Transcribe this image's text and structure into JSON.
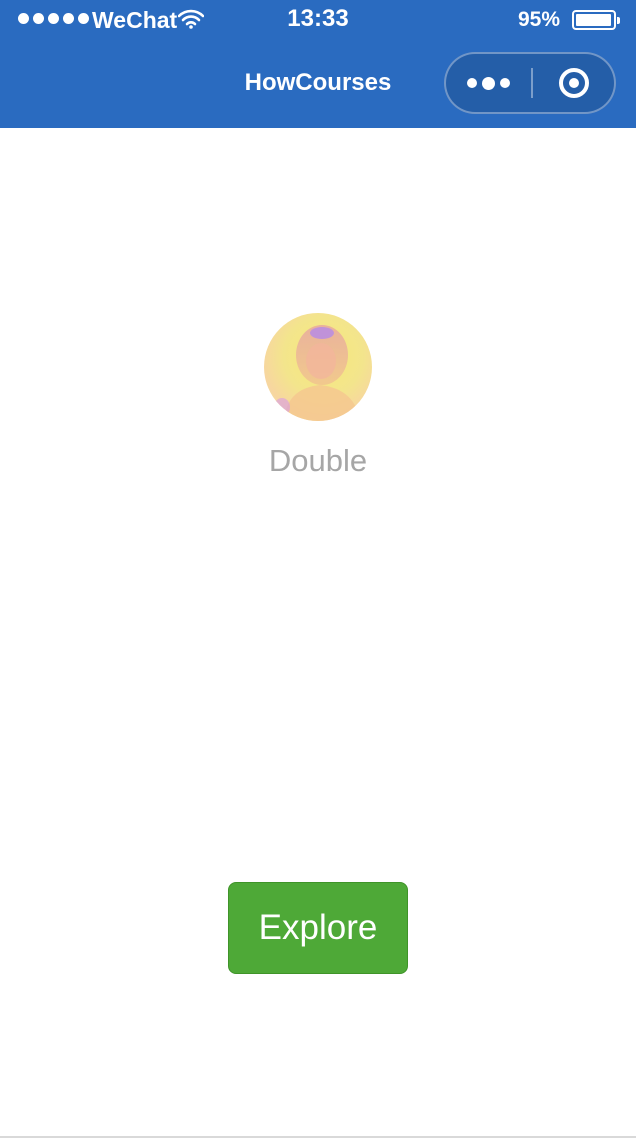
{
  "status_bar": {
    "carrier": "WeChat",
    "time": "13:33",
    "battery_percent": "95%",
    "battery_level": 0.95,
    "signal_bars": 5
  },
  "nav_bar": {
    "title": "HowCourses",
    "background_color": "#2a6bc0"
  },
  "profile": {
    "name": "Double"
  },
  "actions": {
    "explore_label": "Explore",
    "explore_color": "#4ea937"
  }
}
